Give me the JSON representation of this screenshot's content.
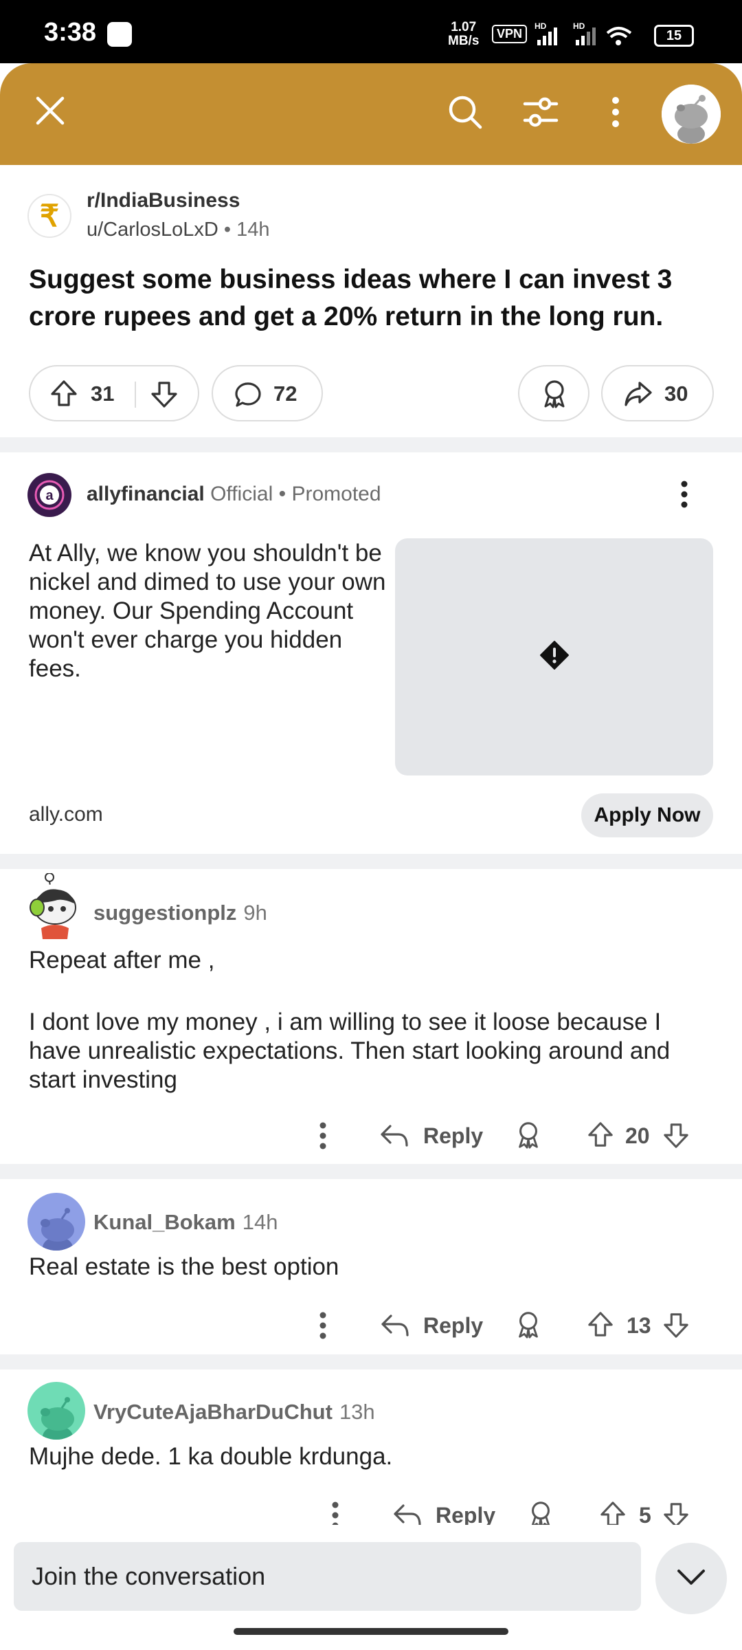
{
  "status_bar": {
    "time": "3:38",
    "speed": "1.07\nMB/s",
    "speed_top": "1.07",
    "speed_bottom": "MB/s",
    "vpn": "VPN",
    "battery": "15"
  },
  "colors": {
    "header_bg": "#c48f32",
    "divider": "#f0f1f3",
    "pill_border": "#dcdcdc"
  },
  "header": {
    "icons": [
      "close-icon",
      "search-icon",
      "filter-icon",
      "more-vertical-icon",
      "user-avatar"
    ]
  },
  "post": {
    "subreddit": "r/IndiaBusiness",
    "author": "u/CarlosLoLxD",
    "separator": "•",
    "age": "14h",
    "title": "Suggest some business ideas where I can invest 3 crore rupees and get a 20% return in the long run.",
    "upvotes": "31",
    "comments": "72",
    "shares": "30"
  },
  "ad": {
    "advertiser": "allyfinancial",
    "official": "Official",
    "separator": "•",
    "promoted": "Promoted",
    "text": "At Ally, we know you shouldn't be nickel and dimed to use your own money. Our Spending Account won't ever charge you hidden fees.",
    "domain": "ally.com",
    "cta": "Apply Now"
  },
  "comments": [
    {
      "user": "suggestionplz",
      "age": "9h",
      "body_line1": "Repeat after me ,",
      "body_line2": "I dont love my money , i am willing to see it loose because I have unrealistic expectations. Then start looking around and start investing",
      "reply": "Reply",
      "score": "20"
    },
    {
      "user": "Kunal_Bokam",
      "age": "14h",
      "body_line1": "Real estate is the best option",
      "reply": "Reply",
      "score": "13"
    },
    {
      "user": "VryCuteAjaBharDuChut",
      "age": "13h",
      "body_line1": "Mujhe dede. 1 ka double krdunga.",
      "reply": "Reply",
      "score": "5"
    }
  ],
  "footer": {
    "join_placeholder": "Join the conversation"
  }
}
